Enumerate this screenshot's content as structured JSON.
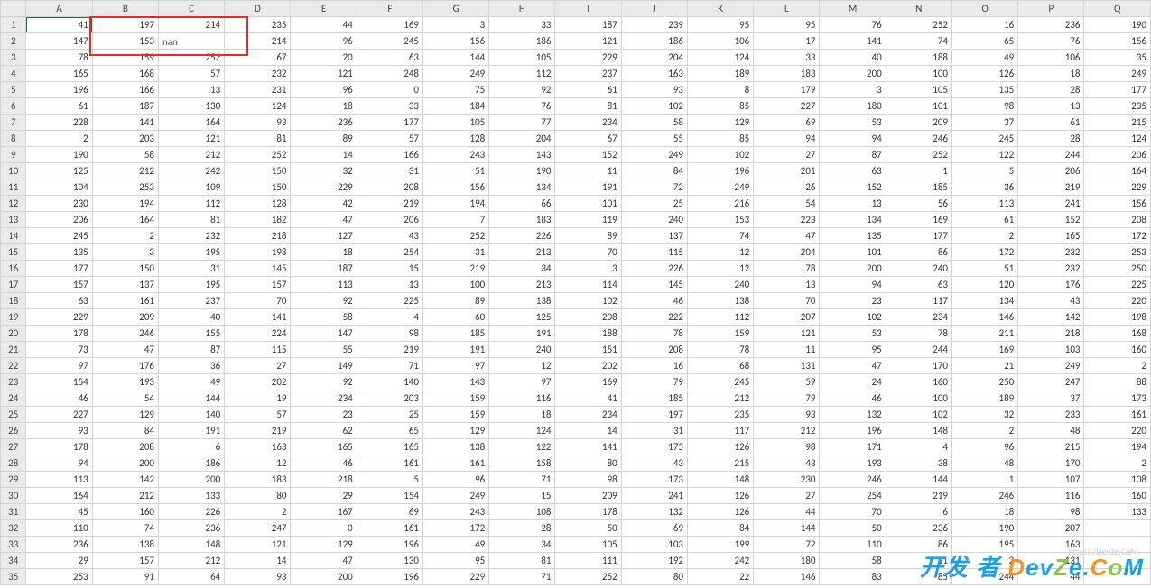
{
  "columns": [
    "A",
    "B",
    "C",
    "D",
    "E",
    "F",
    "G",
    "H",
    "I",
    "J",
    "K",
    "L",
    "M",
    "N",
    "O",
    "P",
    "Q"
  ],
  "row_numbers": [
    1,
    2,
    3,
    4,
    5,
    6,
    7,
    8,
    9,
    10,
    11,
    12,
    13,
    14,
    15,
    16,
    17,
    18,
    19,
    20,
    21,
    22,
    23,
    24,
    25,
    26,
    27,
    28,
    29,
    30,
    31,
    32,
    33,
    34,
    35
  ],
  "annotation_text": "nan",
  "selected_cell": "A1",
  "watermark": {
    "url_hint": "DevZe.CoM",
    "chinese": "开发 者"
  },
  "rows": [
    [
      41,
      197,
      214,
      235,
      44,
      169,
      3,
      33,
      187,
      239,
      95,
      95,
      76,
      252,
      16,
      236,
      190
    ],
    [
      147,
      153,
      null,
      214,
      96,
      245,
      156,
      186,
      121,
      186,
      106,
      17,
      141,
      74,
      65,
      76,
      156
    ],
    [
      78,
      159,
      252,
      67,
      20,
      63,
      144,
      105,
      229,
      204,
      124,
      33,
      40,
      188,
      49,
      106,
      35
    ],
    [
      165,
      168,
      57,
      232,
      121,
      248,
      249,
      112,
      237,
      163,
      189,
      183,
      200,
      100,
      126,
      18,
      249
    ],
    [
      196,
      166,
      13,
      231,
      96,
      0,
      75,
      92,
      61,
      93,
      8,
      179,
      3,
      105,
      135,
      28,
      177
    ],
    [
      61,
      187,
      130,
      124,
      18,
      33,
      184,
      76,
      81,
      102,
      85,
      227,
      180,
      101,
      98,
      13,
      235
    ],
    [
      228,
      141,
      164,
      93,
      236,
      177,
      105,
      77,
      234,
      58,
      129,
      69,
      53,
      209,
      37,
      61,
      215
    ],
    [
      2,
      203,
      121,
      81,
      89,
      57,
      128,
      204,
      67,
      55,
      85,
      94,
      94,
      246,
      245,
      28,
      124
    ],
    [
      190,
      58,
      212,
      252,
      14,
      166,
      243,
      143,
      152,
      249,
      102,
      27,
      87,
      252,
      122,
      244,
      206
    ],
    [
      125,
      212,
      242,
      150,
      32,
      31,
      51,
      190,
      11,
      84,
      196,
      201,
      63,
      1,
      5,
      206,
      164
    ],
    [
      104,
      253,
      109,
      150,
      229,
      208,
      156,
      134,
      191,
      72,
      249,
      26,
      152,
      185,
      36,
      219,
      229
    ],
    [
      230,
      194,
      112,
      128,
      42,
      219,
      194,
      66,
      101,
      25,
      216,
      54,
      13,
      56,
      113,
      241,
      156
    ],
    [
      206,
      164,
      81,
      182,
      47,
      206,
      7,
      183,
      119,
      240,
      153,
      223,
      134,
      169,
      61,
      152,
      208
    ],
    [
      245,
      2,
      232,
      218,
      127,
      43,
      252,
      226,
      89,
      137,
      74,
      47,
      135,
      177,
      2,
      165,
      172
    ],
    [
      135,
      3,
      195,
      198,
      18,
      254,
      31,
      213,
      70,
      115,
      12,
      204,
      101,
      86,
      172,
      232,
      253
    ],
    [
      177,
      150,
      31,
      145,
      187,
      15,
      219,
      34,
      3,
      226,
      12,
      78,
      200,
      240,
      51,
      232,
      250
    ],
    [
      157,
      137,
      195,
      157,
      113,
      13,
      100,
      213,
      114,
      145,
      240,
      13,
      94,
      63,
      120,
      176,
      225
    ],
    [
      63,
      161,
      237,
      70,
      92,
      225,
      89,
      138,
      102,
      46,
      138,
      70,
      23,
      117,
      134,
      43,
      220
    ],
    [
      229,
      209,
      40,
      141,
      58,
      4,
      60,
      125,
      208,
      222,
      112,
      207,
      102,
      234,
      146,
      142,
      198
    ],
    [
      178,
      246,
      155,
      224,
      147,
      98,
      185,
      191,
      188,
      78,
      159,
      121,
      53,
      78,
      211,
      218,
      168
    ],
    [
      73,
      47,
      87,
      115,
      55,
      219,
      191,
      240,
      151,
      208,
      78,
      11,
      95,
      244,
      169,
      103,
      160
    ],
    [
      97,
      176,
      36,
      27,
      149,
      71,
      97,
      12,
      202,
      16,
      68,
      131,
      47,
      170,
      21,
      249,
      2
    ],
    [
      154,
      193,
      49,
      202,
      92,
      140,
      143,
      97,
      169,
      79,
      245,
      59,
      24,
      160,
      250,
      247,
      88
    ],
    [
      46,
      54,
      144,
      19,
      234,
      203,
      159,
      116,
      41,
      185,
      212,
      79,
      46,
      100,
      189,
      37,
      173
    ],
    [
      227,
      129,
      140,
      57,
      23,
      25,
      159,
      18,
      234,
      197,
      235,
      93,
      132,
      102,
      32,
      233,
      161
    ],
    [
      93,
      84,
      191,
      219,
      62,
      65,
      129,
      124,
      14,
      31,
      117,
      212,
      196,
      148,
      2,
      48,
      220
    ],
    [
      178,
      208,
      6,
      163,
      165,
      165,
      138,
      122,
      141,
      175,
      126,
      98,
      171,
      4,
      96,
      215,
      194
    ],
    [
      94,
      200,
      186,
      12,
      46,
      161,
      161,
      158,
      80,
      43,
      215,
      43,
      193,
      38,
      48,
      170,
      2
    ],
    [
      113,
      142,
      200,
      183,
      218,
      5,
      96,
      71,
      98,
      173,
      148,
      230,
      246,
      144,
      1,
      107,
      108
    ],
    [
      164,
      212,
      133,
      80,
      29,
      154,
      249,
      15,
      209,
      241,
      126,
      27,
      254,
      219,
      246,
      116,
      160
    ],
    [
      45,
      160,
      226,
      2,
      167,
      69,
      243,
      108,
      178,
      132,
      126,
      44,
      70,
      6,
      18,
      98,
      133
    ],
    [
      110,
      74,
      236,
      247,
      0,
      161,
      172,
      28,
      50,
      69,
      84,
      144,
      50,
      236,
      190,
      207,
      null
    ],
    [
      236,
      138,
      148,
      121,
      129,
      196,
      49,
      34,
      105,
      103,
      199,
      72,
      110,
      86,
      195,
      163,
      null
    ],
    [
      29,
      157,
      212,
      14,
      47,
      130,
      95,
      81,
      111,
      192,
      242,
      180,
      58,
      11,
      2,
      131,
      null
    ],
    [
      253,
      91,
      64,
      93,
      200,
      196,
      229,
      71,
      252,
      80,
      22,
      146,
      83,
      85,
      244,
      44,
      null
    ]
  ]
}
